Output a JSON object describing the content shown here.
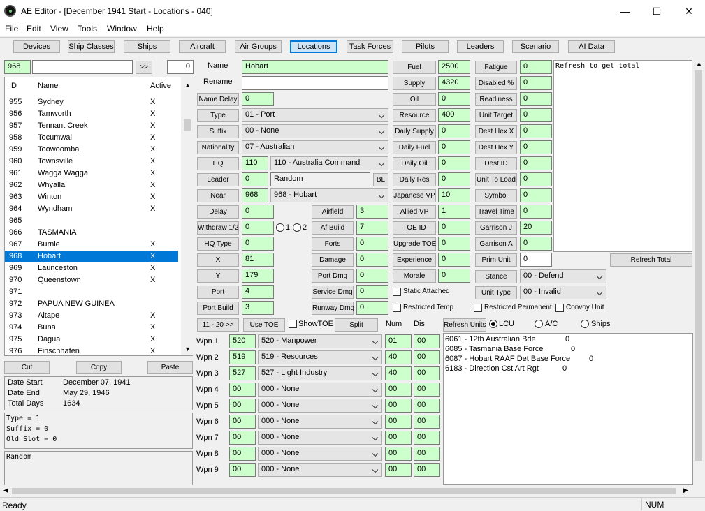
{
  "window": {
    "title": "AE Editor - [December 1941 Start - Locations - 040]",
    "min": "—",
    "max": "☐",
    "close": "✕"
  },
  "menu": [
    "File",
    "Edit",
    "View",
    "Tools",
    "Window",
    "Help"
  ],
  "tabs": [
    "Devices",
    "Ship Classes",
    "Ships",
    "Aircraft",
    "Air Groups",
    "Locations",
    "Task Forces",
    "Pilots",
    "Leaders",
    "Scenario",
    "AI Data"
  ],
  "nav": {
    "id": "968",
    "search": "",
    "go": ">>",
    "count": "0"
  },
  "list": {
    "headers": [
      "ID",
      "Name",
      "Active"
    ],
    "rows": [
      [
        "955",
        "Sydney",
        "X"
      ],
      [
        "956",
        "Tamworth",
        "X"
      ],
      [
        "957",
        "Tennant Creek",
        "X"
      ],
      [
        "958",
        "Tocumwal",
        "X"
      ],
      [
        "959",
        "Toowoomba",
        "X"
      ],
      [
        "960",
        "Townsville",
        "X"
      ],
      [
        "961",
        "Wagga Wagga",
        "X"
      ],
      [
        "962",
        "Whyalla",
        "X"
      ],
      [
        "963",
        "Winton",
        "X"
      ],
      [
        "964",
        "Wyndham",
        "X"
      ],
      [
        "965",
        "",
        ""
      ],
      [
        "966",
        "TASMANIA",
        ""
      ],
      [
        "967",
        "Burnie",
        "X"
      ],
      [
        "968",
        "Hobart",
        "X"
      ],
      [
        "969",
        "Launceston",
        "X"
      ],
      [
        "970",
        "Queenstown",
        "X"
      ],
      [
        "971",
        "",
        ""
      ],
      [
        "972",
        "PAPUA NEW GUINEA",
        ""
      ],
      [
        "973",
        "Aitape",
        "X"
      ],
      [
        "974",
        "Buna",
        "X"
      ],
      [
        "975",
        "Dagua",
        "X"
      ],
      [
        "976",
        "Finschhafen",
        "X"
      ]
    ],
    "selected": 13
  },
  "edit_buttons": {
    "cut": "Cut",
    "copy": "Copy",
    "paste": "Paste"
  },
  "dates": {
    "start_label": "Date Start",
    "start": "December 07, 1941",
    "end_label": "Date End",
    "end": "May 29, 1946",
    "total_label": "Total Days",
    "total": "1634"
  },
  "info1": [
    "Type = 1",
    "Suffix = 0",
    "Old Slot = 0"
  ],
  "info2": "Random",
  "form": {
    "name_label": "Name",
    "name": "Hobart",
    "rename_label": "Rename",
    "rename": "",
    "name_delay_label": "Name Delay",
    "name_delay": "0",
    "type_label": "Type",
    "type": "01 - Port",
    "suffix_label": "Suffix",
    "suffix": "00 - None",
    "nationality_label": "Nationality",
    "nationality": "07 - Australian",
    "hq_label": "HQ",
    "hq": "110",
    "hq_sel": "110 - Australia Command",
    "leader_label": "Leader",
    "leader": "0",
    "leader_name": "Random",
    "bl": "BL",
    "near_label": "Near",
    "near": "968",
    "near_sel": "968 - Hobart",
    "delay_label": "Delay",
    "delay": "0",
    "withdraw_label": "Withdraw 1/2",
    "withdraw": "0",
    "r1": "1",
    "r2": "2",
    "hqtype_label": "HQ Type",
    "hqtype": "0",
    "x_label": "X",
    "x": "81",
    "y_label": "Y",
    "y": "179",
    "port_label": "Port",
    "port": "4",
    "portbuild_label": "Port Build",
    "portbuild": "3",
    "airfield_label": "Airfield",
    "airfield": "3",
    "afbuild_label": "Af Build",
    "afbuild": "7",
    "forts_label": "Forts",
    "forts": "0",
    "damage_label": "Damage",
    "damage": "0",
    "portdmg_label": "Port Dmg",
    "portdmg": "0",
    "servicedmg_label": "Service Dmg",
    "servicedmg": "0",
    "runwaydmg_label": "Runway Dmg",
    "runwaydmg": "0",
    "fuel_label": "Fuel",
    "fuel": "2500",
    "supply_label": "Supply",
    "supply": "4320",
    "oil_label": "Oil",
    "oil": "0",
    "resource_label": "Resource",
    "resource": "400",
    "dsupply_label": "Daily Supply",
    "dsupply": "0",
    "dfuel_label": "Daily Fuel",
    "dfuel": "0",
    "doil_label": "Daily Oil",
    "doil": "0",
    "dres_label": "Daily Res",
    "dres": "0",
    "jvp_label": "Japanese VP",
    "jvp": "10",
    "avp_label": "Allied VP",
    "avp": "1",
    "toeid_label": "TOE ID",
    "toeid": "0",
    "upgtoe_label": "Upgrade TOE",
    "upgtoe": "0",
    "exp_label": "Experience",
    "exp": "0",
    "morale_label": "Morale",
    "morale": "0",
    "static_label": "Static Attached",
    "rtemp_label": "Restricted Temp",
    "fatigue_label": "Fatigue",
    "fatigue": "0",
    "disabled_label": "Disabled %",
    "disabled": "0",
    "readiness_label": "Readiness",
    "readiness": "0",
    "utarget_label": "Unit Target",
    "utarget": "0",
    "dhx_label": "Dest Hex X",
    "dhx": "0",
    "dhy_label": "Dest Hex Y",
    "dhy": "0",
    "destid_label": "Dest ID",
    "destid": "0",
    "utl_label": "Unit To Load",
    "utl": "0",
    "symbol_label": "Symbol",
    "symbol": "0",
    "travel_label": "Travel Time",
    "travel": "0",
    "garj_label": "Garrison J",
    "garj": "20",
    "gara_label": "Garrison A",
    "gara": "0",
    "primunit_label": "Prim Unit",
    "primunit": "0",
    "stance_label": "Stance",
    "stance": "00 - Defend",
    "utype_label": "Unit Type",
    "utype": "00 - Invalid",
    "rperm_label": "Restricted Permanent",
    "convoy_label": "Convoy Unit",
    "notes": "Refresh to get total",
    "refresh_total": "Refresh Total"
  },
  "weapons": {
    "page_btn": "11 - 20 >>",
    "use_toe": "Use TOE",
    "show_toe": "ShowTOE",
    "split": "Split",
    "num_label": "Num",
    "dis_label": "Dis",
    "rows": [
      {
        "label": "Wpn 1",
        "id": "520",
        "sel": "520 - Manpower",
        "num": "01",
        "dis": "00"
      },
      {
        "label": "Wpn 2",
        "id": "519",
        "sel": "519 - Resources",
        "num": "40",
        "dis": "00"
      },
      {
        "label": "Wpn 3",
        "id": "527",
        "sel": "527 - Light Industry",
        "num": "40",
        "dis": "00"
      },
      {
        "label": "Wpn 4",
        "id": "00",
        "sel": "000 - None",
        "num": "00",
        "dis": "00"
      },
      {
        "label": "Wpn 5",
        "id": "00",
        "sel": "000 - None",
        "num": "00",
        "dis": "00"
      },
      {
        "label": "Wpn 6",
        "id": "00",
        "sel": "000 - None",
        "num": "00",
        "dis": "00"
      },
      {
        "label": "Wpn 7",
        "id": "00",
        "sel": "000 - None",
        "num": "00",
        "dis": "00"
      },
      {
        "label": "Wpn 8",
        "id": "00",
        "sel": "000 - None",
        "num": "00",
        "dis": "00"
      },
      {
        "label": "Wpn 9",
        "id": "00",
        "sel": "000 - None",
        "num": "00",
        "dis": "00"
      }
    ]
  },
  "units": {
    "refresh": "Refresh Units",
    "lcu": "LCU",
    "ac": "A/C",
    "ships": "Ships",
    "rows": [
      [
        "6061 - 12th Australian Bde",
        "0"
      ],
      [
        "6085 - Tasmania Base Force",
        "0"
      ],
      [
        "6087 - Hobart RAAF Det Base Force",
        "0"
      ],
      [
        "6183 - Direction Cst Art Rgt",
        "0"
      ]
    ]
  },
  "status": {
    "text": "Ready",
    "num": "NUM"
  }
}
